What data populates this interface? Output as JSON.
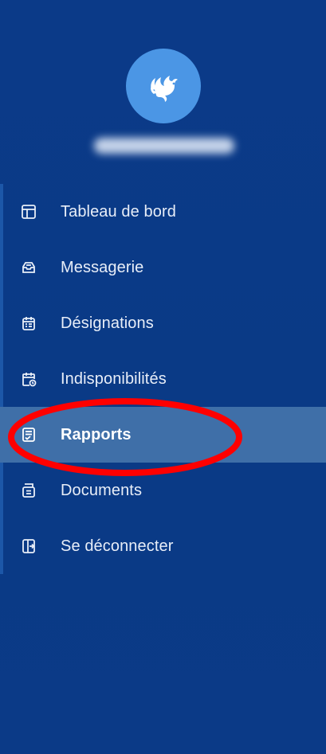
{
  "colors": {
    "sidebar_bg": "#0a3a86",
    "avatar_bg": "#4b96e5",
    "active_bg": "#3f6fa8",
    "annotation": "#ff0000"
  },
  "profile": {
    "logo_icon": "rooster-logo-icon"
  },
  "menu": {
    "items": [
      {
        "label": "Tableau de bord",
        "icon": "layout-icon"
      },
      {
        "label": "Messagerie",
        "icon": "inbox-icon"
      },
      {
        "label": "Désignations",
        "icon": "calendar-list-icon"
      },
      {
        "label": "Indisponibilités",
        "icon": "calendar-clock-icon"
      },
      {
        "label": "Rapports",
        "icon": "report-icon",
        "active": true
      },
      {
        "label": "Documents",
        "icon": "archive-icon"
      },
      {
        "label": "Se déconnecter",
        "icon": "logout-icon"
      }
    ]
  }
}
